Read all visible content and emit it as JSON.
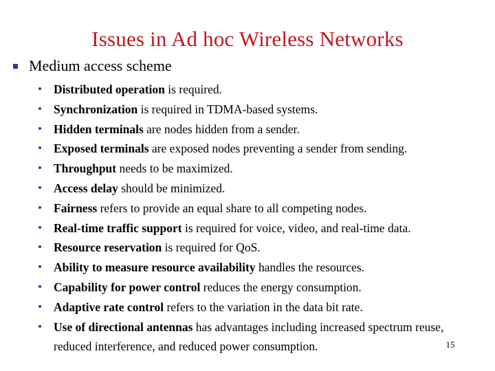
{
  "slide": {
    "title": "Issues in Ad hoc Wireless Networks",
    "title_color": "#C0171C",
    "background_color": "#ffffff",
    "bullet_color": "#333399",
    "text_color": "#000000",
    "number": "15"
  },
  "level1": {
    "bullet_glyph": "§",
    "bullet_shape": "square",
    "text": "Medium access scheme"
  },
  "sub_bullets": [
    {
      "lead": "Distributed operation",
      "tail": " is required."
    },
    {
      "lead": "Synchronization",
      "tail": " is required  in TDMA-based systems."
    },
    {
      "lead": "Hidden terminals",
      "tail": " are nodes hidden from a sender."
    },
    {
      "lead": "Exposed terminals",
      "tail": " are exposed nodes preventing a sender from sending."
    },
    {
      "lead": "Throughput",
      "tail": " needs to be maximized."
    },
    {
      "lead": "Access delay",
      "tail": " should be minimized."
    },
    {
      "lead": "Fairness",
      "tail": " refers  to provide an equal share to all competing nodes."
    },
    {
      "lead": "Real-time traffic support",
      "tail": " is required for voice, video, and real-time data."
    },
    {
      "lead": "Resource reservation",
      "tail": " is required for QoS."
    },
    {
      "lead": "Ability to measure resource availability",
      "tail": " handles the resources."
    },
    {
      "lead": "Capability for power control",
      "tail": " reduces the energy consumption."
    },
    {
      "lead": "Adaptive rate control",
      "tail": " refers to  the variation in the data bit  rate."
    },
    {
      "lead": "Use of directional antennas",
      "tail": " has advantages including increased spectrum reuse, reduced interference, and reduced power consumption."
    }
  ]
}
